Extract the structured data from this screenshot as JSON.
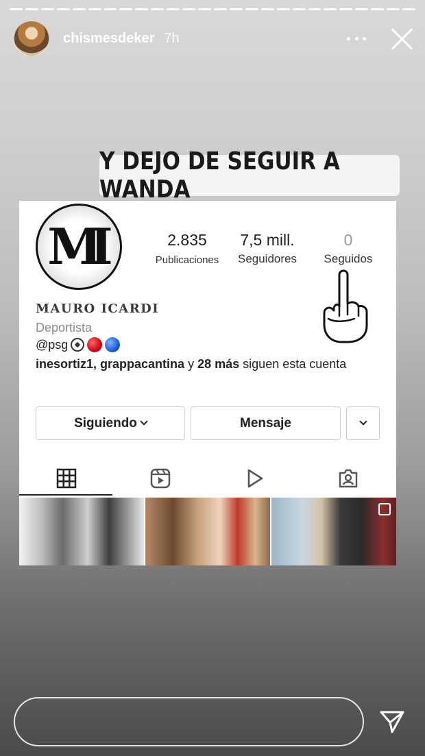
{
  "story": {
    "segments": 26,
    "active_segment": 26
  },
  "header": {
    "username": "chismesdeker",
    "time": "7h",
    "icons": {
      "more": "more-dots-icon",
      "close": "close-icon"
    }
  },
  "caption": {
    "text": "Y DEJO DE SEGUIR A WANDA"
  },
  "profile": {
    "stats": [
      {
        "value": "2.835",
        "label": "Publicaciones"
      },
      {
        "value": "7,5 mill.",
        "label": "Seguidores"
      },
      {
        "value": "0",
        "label": "Seguidos"
      }
    ],
    "name": "MAURO ICARDI",
    "category": "Deportista",
    "bio_handle": "@psg",
    "mutual": {
      "users": "inesortiz1, grappacantina",
      "conj": "y",
      "more": "28 más",
      "suffix": "siguen esta cuenta"
    },
    "buttons": {
      "follow": "Siguiendo",
      "message": "Mensaje"
    },
    "tabs": [
      "grid-icon",
      "reels-icon",
      "video-icon",
      "tagged-icon"
    ],
    "logo_letters": "MI"
  },
  "reply": {
    "placeholder": "",
    "send_icon": "send-icon"
  }
}
